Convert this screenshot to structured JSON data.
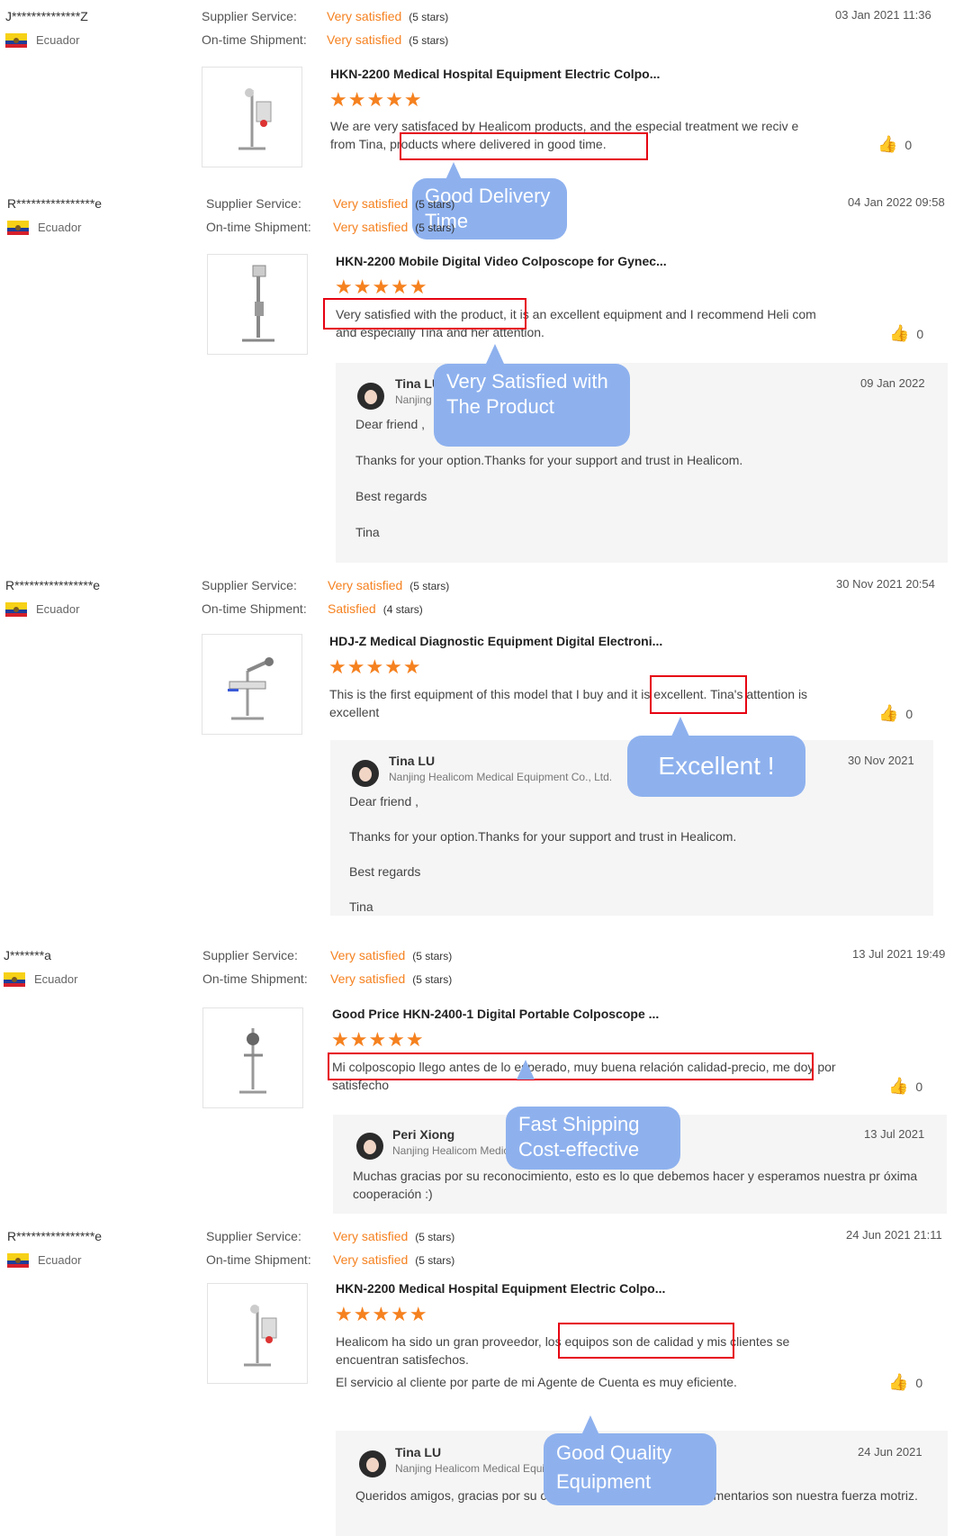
{
  "common": {
    "country": "Ecuador",
    "supplier_label": "Supplier Service:",
    "shipment_label": "On-time Shipment:",
    "stars_glyph": "★★★★★",
    "thumb_icon": "colposcope-product-icon",
    "like_icon": "thumbs-up-icon",
    "accent_color": "#f5811f",
    "highlight_color": "#e60012",
    "bubble_color": "#8eb1ee"
  },
  "reviews": [
    {
      "name": "J**************Z",
      "supplier_value": "Very satisfied",
      "supplier_stars": "(5 stars)",
      "shipment_value": "Very satisfied",
      "shipment_stars": "(5 stars)",
      "date": "03 Jan 2021 11:36",
      "title": "HKN-2200 Medical Hospital Equipment Electric Colpo...",
      "rating": 5,
      "text": "We are very satisfaced by Healicom products, and the especial treatment we reciv e from Tina, products where delivered in good time.",
      "likes": "0",
      "callout": "Good Delivery Time"
    },
    {
      "name": "R****************e",
      "supplier_value": "Very satisfied",
      "supplier_stars": "(5 stars)",
      "shipment_value": "Very satisfied",
      "shipment_stars": "(5 stars)",
      "date": "04 Jan 2022 09:58",
      "title": "HKN-2200 Mobile Digital Video Colposcope for Gynec...",
      "rating": 5,
      "text": "Very satisfied with the product, it is an excellent equipment and I recommend Heli com and especially Tina and her attention.",
      "likes": "0",
      "callout": "Very Satisfied with The Product",
      "reply": {
        "name": "Tina LU",
        "company": "Nanjing Healicom Medical Equipment Co., Ltd.",
        "date": "09 Jan 2022",
        "lines": [
          "Dear friend ,",
          "Thanks for your option.Thanks for your support and trust in Healicom.",
          "Best regards",
          "Tina"
        ]
      }
    },
    {
      "name": "R****************e",
      "supplier_value": "Very satisfied",
      "supplier_stars": "(5 stars)",
      "shipment_value": "Satisfied",
      "shipment_stars": "(4 stars)",
      "date": "30 Nov 2021 20:54",
      "title": "HDJ-Z Medical Diagnostic Equipment Digital Electroni...",
      "rating": 5,
      "text": "This is the first equipment of this model that I buy and it is excellent. Tina's attention is excellent",
      "likes": "0",
      "callout": "Excellent !",
      "reply": {
        "name": "Tina LU",
        "company": "Nanjing Healicom Medical Equipment Co., Ltd.",
        "date": "30 Nov 2021",
        "lines": [
          "Dear friend ,",
          "Thanks for your option.Thanks for your support and trust in Healicom.",
          "Best regards",
          "Tina"
        ]
      }
    },
    {
      "name": "J*******a",
      "supplier_value": "Very satisfied",
      "supplier_stars": "(5 stars)",
      "shipment_value": "Very satisfied",
      "shipment_stars": "(5 stars)",
      "date": "13 Jul 2021 19:49",
      "title": "Good Price HKN-2400-1 Digital Portable Colposcope ...",
      "rating": 5,
      "text": "Mi colposcopio llego antes de lo esperado, muy buena relación calidad-precio, me doy por satisfecho",
      "likes": "0",
      "callout": "Fast Shipping Cost-effective",
      "reply": {
        "name": "Peri Xiong",
        "company": "Nanjing Healicom Medical Equipment Co., Ltd.",
        "date": "13 Jul 2021",
        "lines": [
          "Muchas gracias por su reconocimiento, esto es lo que debemos hacer y esperamos nuestra pr óxima cooperación :)"
        ]
      }
    },
    {
      "name": "R****************e",
      "supplier_value": "Very satisfied",
      "supplier_stars": "(5 stars)",
      "shipment_value": "Very satisfied",
      "shipment_stars": "(5 stars)",
      "date": "24 Jun 2021 21:11",
      "title": "HKN-2200 Medical Hospital Equipment Electric Colpo...",
      "rating": 5,
      "text": "Healicom ha sido un gran proveedor, los equipos son de calidad y mis clientes se encuentran satisfechos.",
      "text2": "El servicio al cliente por parte de mi Agente de Cuenta es muy eficiente.",
      "likes": "0",
      "callout": "Good Quality Equipment",
      "reply": {
        "name": "Tina LU",
        "company": "Nanjing Healicom Medical Equipment Co., Ltd.",
        "date": "24 Jun 2021",
        "lines": [
          "Queridos amigos, gracias por su confianza en Healicom. Sus comentarios son nuestra fuerza motriz."
        ]
      }
    }
  ]
}
